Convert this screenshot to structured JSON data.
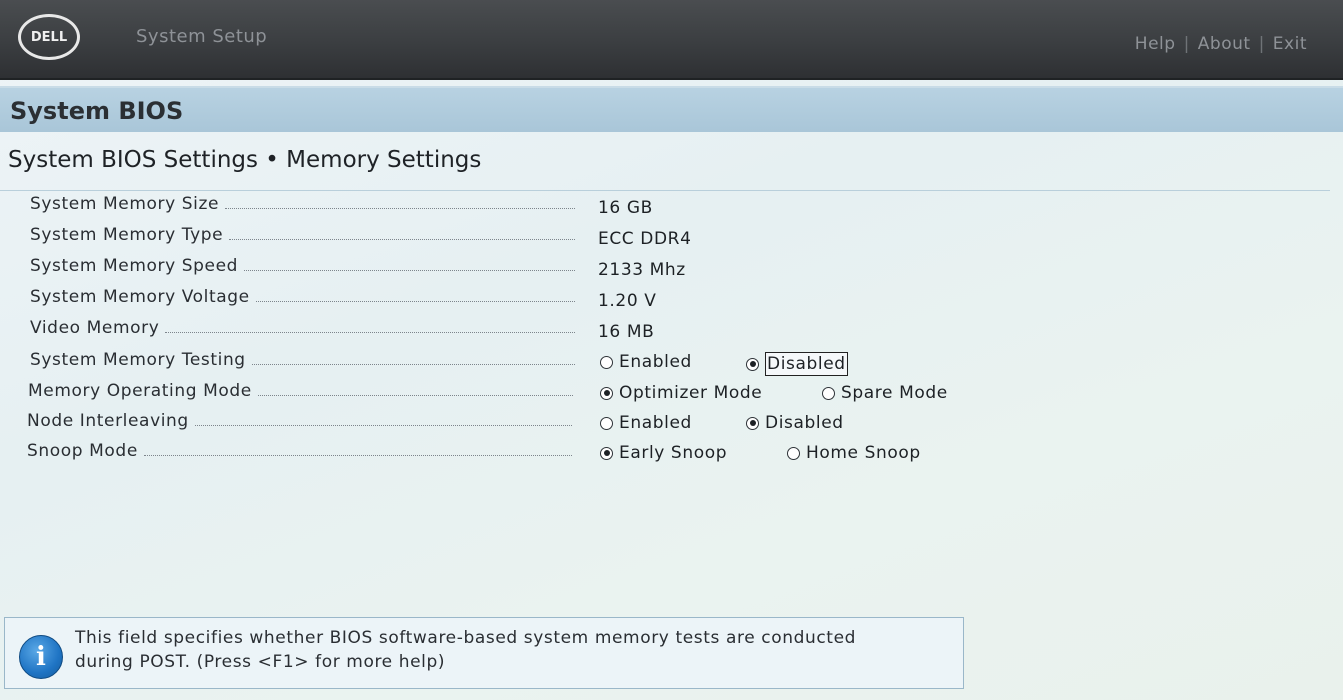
{
  "header": {
    "logo_text": "DELL",
    "app_title": "System Setup",
    "nav": [
      {
        "label": "Help"
      },
      {
        "label": "About"
      },
      {
        "label": "Exit"
      }
    ],
    "separator": "|"
  },
  "banner": {
    "title": "System BIOS"
  },
  "breadcrumb": "System BIOS Settings • Memory Settings",
  "settings": {
    "memory_size": {
      "label": "System Memory Size",
      "value": "16 GB"
    },
    "memory_type": {
      "label": "System Memory Type",
      "value": "ECC DDR4"
    },
    "memory_speed": {
      "label": "System Memory Speed",
      "value": "2133 Mhz"
    },
    "memory_voltage": {
      "label": "System Memory Voltage",
      "value": "1.20 V"
    },
    "video_memory": {
      "label": "Video Memory",
      "value": "16 MB"
    },
    "memory_testing": {
      "label": "System Memory Testing",
      "options": [
        "Enabled",
        "Disabled"
      ],
      "selected": "Disabled"
    },
    "operating_mode": {
      "label": "Memory Operating Mode",
      "options": [
        "Optimizer Mode",
        "Spare Mode"
      ],
      "selected": "Optimizer Mode"
    },
    "node_interleaving": {
      "label": "Node Interleaving",
      "options": [
        "Enabled",
        "Disabled"
      ],
      "selected": "Disabled"
    },
    "snoop_mode": {
      "label": "Snoop Mode",
      "options": [
        "Early Snoop",
        "Home Snoop"
      ],
      "selected": "Early Snoop"
    }
  },
  "help": {
    "icon": "info-icon",
    "line1": "This field specifies whether BIOS software-based system memory tests are conducted",
    "line2": "during POST. (Press <F1> for more help)"
  },
  "colors": {
    "header_bg": "#3b3e41",
    "banner_bg": "#b8d2e2",
    "info_icon": "#1f74c4"
  }
}
